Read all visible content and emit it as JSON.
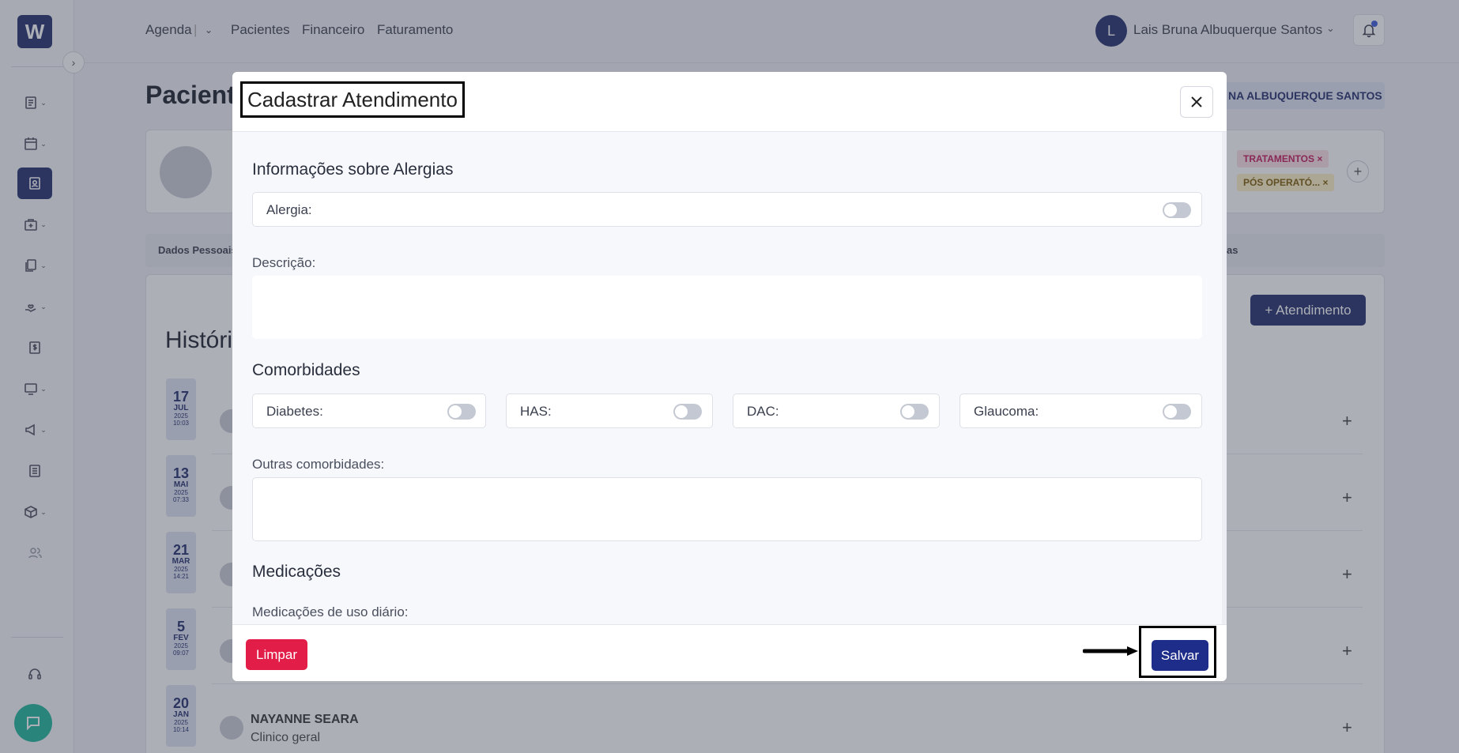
{
  "app": {
    "logo_letter": "W"
  },
  "topnav": {
    "items": [
      "Agenda",
      "|",
      "Pacientes",
      "Financeiro",
      "Faturamento"
    ],
    "user_initial": "L",
    "user_name": "Lais Bruna Albuquerque Santos"
  },
  "background": {
    "page_title": "Pacient",
    "patient_badge": "NA ALBUQUERQUE SANTOS",
    "tags": [
      "TRATAMENTOS ×",
      "PÓS OPERATÓ... ×"
    ],
    "tab_left": "Dados Pessoais",
    "tab_right": "as",
    "history_title": "Históri",
    "atendimento_button": "+ Atendimento",
    "dates": [
      {
        "day": "17",
        "month": "JUL",
        "year": "2025",
        "time": "10:03"
      },
      {
        "day": "13",
        "month": "MAI",
        "year": "2025",
        "time": "07:33"
      },
      {
        "day": "21",
        "month": "MAR",
        "year": "2025",
        "time": "14:21"
      },
      {
        "day": "5",
        "month": "FEV",
        "year": "2025",
        "time": "09:07"
      },
      {
        "day": "20",
        "month": "JAN",
        "year": "2025",
        "time": "10:14"
      }
    ],
    "last_row": {
      "name": "NAYANNE SEARA",
      "specialty": "Clinico geral"
    }
  },
  "modal": {
    "title": "Cadastrar Atendimento",
    "sections": {
      "alergias": "Informações sobre Alergias",
      "comorbidades": "Comorbidades",
      "medicacoes": "Medicações"
    },
    "fields": {
      "alergia": "Alergia:",
      "descricao": "Descrição:",
      "diabetes": "Diabetes:",
      "has": "HAS:",
      "dac": "DAC:",
      "glaucoma": "Glaucoma:",
      "outras_comorbidades": "Outras comorbidades:",
      "medicacoes_uso_diario": "Medicações de uso diário:"
    },
    "toggles": {
      "alergia": false,
      "diabetes": false,
      "has": false,
      "dac": false,
      "glaucoma": false
    },
    "footer": {
      "clear_label": "Limpar",
      "save_label": "Salvar"
    }
  },
  "colors": {
    "brand": "#1f2d6b",
    "danger": "#e11d48",
    "chat": "#1db59a"
  }
}
